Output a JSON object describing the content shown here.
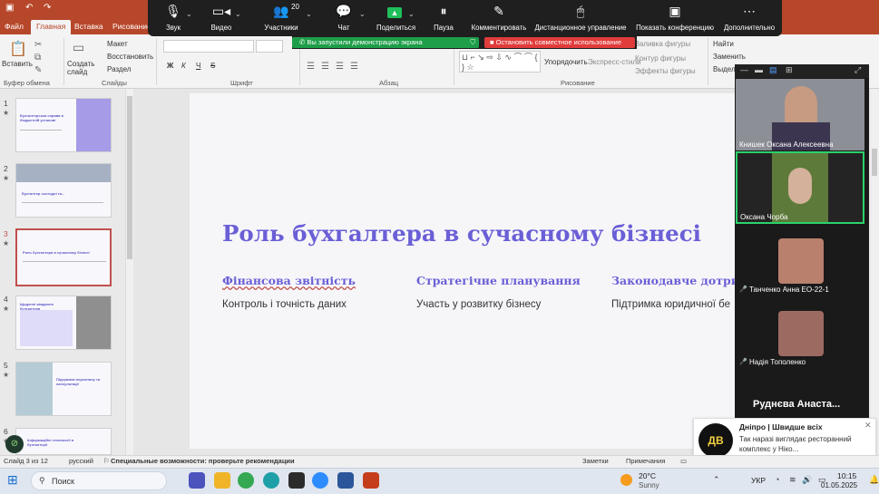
{
  "ribbon": {
    "tabs": [
      "Файл",
      "Главная",
      "Вставка",
      "Рисование"
    ],
    "active_tab": "Главная",
    "clipboard": {
      "paste_label": "Вставить",
      "group": "Буфер обмена"
    },
    "slides": {
      "create_label": "Создать слайд",
      "layout": "Макет",
      "reset": "Восстановить",
      "section": "Раздел",
      "group": "Слайды"
    },
    "font": {
      "group": "Шрифт",
      "bold": "Ж",
      "italic": "К",
      "underline": "Ч",
      "strike": "S"
    },
    "paragraph": {
      "group": "Абзац"
    },
    "drawing": {
      "arrange": "Упорядочить",
      "styles": "Экспресс-стили",
      "fill": "Заливка фигуры",
      "outline": "Контур фигуры",
      "effects": "Эффекты фигуры",
      "group": "Рисование"
    },
    "editing": {
      "find": "Найти",
      "replace": "Заменить",
      "select": "Выделить"
    }
  },
  "zoom": {
    "items": [
      {
        "label": "Звук",
        "icon": "mic-icon"
      },
      {
        "label": "Видео",
        "icon": "video-icon"
      },
      {
        "label": "Участники",
        "icon": "participants-icon",
        "count": "20"
      },
      {
        "label": "Чат",
        "icon": "chat-icon"
      },
      {
        "label": "Поделиться",
        "icon": "share-icon"
      },
      {
        "label": "Пауза",
        "icon": "pause-icon"
      },
      {
        "label": "Комментировать",
        "icon": "annotate-icon"
      },
      {
        "label": "Дистанционное управление",
        "icon": "remote-control-icon"
      },
      {
        "label": "Показать конференцию",
        "icon": "show-meeting-icon"
      },
      {
        "label": "Дополнительно",
        "icon": "more-icon"
      }
    ],
    "share_notice": "Вы запустили демонстрацию экрана",
    "stop_share": "Остановить совместное использование",
    "participants": [
      {
        "name": "Книшек Оксана Алексеевна"
      },
      {
        "name": "Оксана Чорба"
      },
      {
        "name": "Танченко Анна ЕО-22-1"
      },
      {
        "name": "Надія Тополенко"
      },
      {
        "name": "Руднєва Анаста..."
      }
    ]
  },
  "thumbnails": [
    {
      "num": "1",
      "title": "Бухгалтерська справа в бюджетній установі"
    },
    {
      "num": "2",
      "title": "Бухгалтер сьогодні та..."
    },
    {
      "num": "3",
      "title": "Роль бухгалтера в сучасному бізнесі"
    },
    {
      "num": "4",
      "title": "Щоденні завдання бухгалтера"
    },
    {
      "num": "5",
      "title": "Підтримка персоналу та консультації"
    },
    {
      "num": "6",
      "title": "Інформаційні технології в бухгалтерії"
    }
  ],
  "slide": {
    "title": "Роль бухгалтера в сучасному бізнесі",
    "columns": [
      {
        "head": "Фінансова звітність",
        "body": "Контроль і точність даних"
      },
      {
        "head": "Стратегічне планування",
        "body": "Участь у розвитку бізнесу"
      },
      {
        "head": "Законодавче дотрима",
        "body": "Підтримка юридичної бе"
      }
    ]
  },
  "notification": {
    "title": "Дніпро | Швидше всіх",
    "text": "Так наразі виглядає ресторанний комплекс у Ніко..."
  },
  "status": {
    "slide_of": "Слайд 3 из 12",
    "language": "русский",
    "accessibility": "Специальные возможности: проверьте рекомендации",
    "notes": "Заметки",
    "comments": "Примечания"
  },
  "taskbar": {
    "search": "Поиск",
    "weather_temp": "20°C",
    "weather_desc": "Sunny",
    "lang": "УКР",
    "time": "10:15",
    "date": "01.05.2025"
  },
  "colors": {
    "accent_powerpoint": "#b7472a",
    "slide_title": "#6a5fd6",
    "zoom_green": "#1e9e49",
    "zoom_red": "#e13c3c"
  }
}
